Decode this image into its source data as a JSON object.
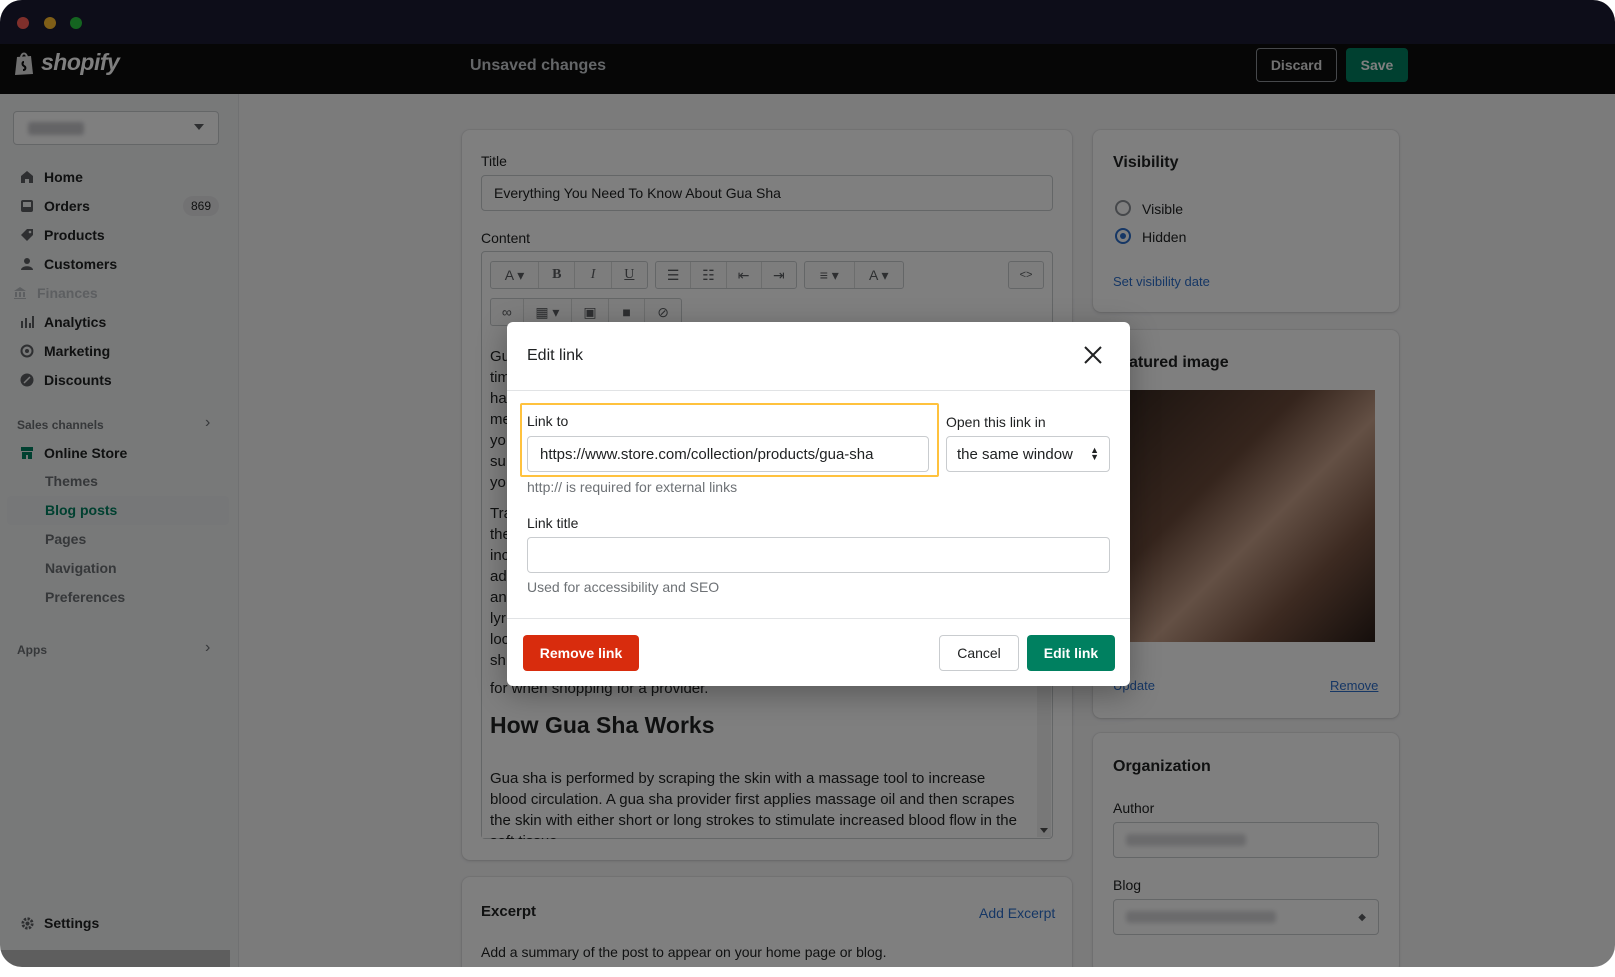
{
  "topbar": {
    "brand": "shopify",
    "status": "Unsaved changes",
    "discard_label": "Discard",
    "save_label": "Save"
  },
  "sidebar": {
    "nav": [
      {
        "label": "Home",
        "icon": "home-icon"
      },
      {
        "label": "Orders",
        "icon": "orders-icon",
        "badge": "869"
      },
      {
        "label": "Products",
        "icon": "tag-icon"
      },
      {
        "label": "Customers",
        "icon": "person-icon"
      },
      {
        "label": "Finances",
        "icon": "bank-icon",
        "disabled": true
      },
      {
        "label": "Analytics",
        "icon": "bar-chart-icon"
      },
      {
        "label": "Marketing",
        "icon": "target-icon"
      },
      {
        "label": "Discounts",
        "icon": "discount-icon"
      }
    ],
    "sales_channels_label": "Sales channels",
    "online_store": "Online Store",
    "online_store_items": [
      "Themes",
      "Blog posts",
      "Pages",
      "Navigation",
      "Preferences"
    ],
    "active_item": "Blog posts",
    "apps_label": "Apps",
    "settings_label": "Settings"
  },
  "main": {
    "title_label": "Title",
    "title_value": "Everything You Need To Know About Gua Sha",
    "content_label": "Content",
    "content": {
      "visible_line_starts": [
        "Gu",
        "tim",
        "ha",
        "me",
        "yo",
        "su",
        "yo",
        "Tra",
        "the",
        "inc",
        "ad",
        "an",
        "lyr",
        "loc",
        "sh"
      ],
      "partial_line": "for when shopping for a provider.",
      "heading": "How Gua Sha Works",
      "paragraph": "Gua sha is performed by scraping the skin with a massage tool to increase blood circulation. A gua sha provider first applies massage oil and then scrapes the skin with either short or long strokes to stimulate increased blood flow in the",
      "cut_line": "soft tissue"
    },
    "excerpt": {
      "title": "Excerpt",
      "action": "Add Excerpt",
      "description": "Add a summary of the post to appear on your home page or blog."
    }
  },
  "right": {
    "visibility": {
      "title": "Visibility",
      "options": [
        "Visible",
        "Hidden"
      ],
      "selected": "Hidden",
      "set_date_link": "Set visibility date"
    },
    "featured_image": {
      "title": "Featured image",
      "visible_title": "atured image",
      "update_label": "Update",
      "remove_label": "Remove"
    },
    "organization": {
      "title": "Organization",
      "author_label": "Author",
      "blog_label": "Blog"
    }
  },
  "modal": {
    "title": "Edit link",
    "link_to_label": "Link to",
    "link_to_value": "https://www.store.com/collection/products/gua-sha",
    "link_to_help": "http:// is required for external links",
    "open_in_label": "Open this link in",
    "open_in_value": "the same window",
    "link_title_label": "Link title",
    "link_title_value": "",
    "link_title_help": "Used for accessibility and SEO",
    "remove_label": "Remove link",
    "cancel_label": "Cancel",
    "submit_label": "Edit link"
  },
  "colors": {
    "primary_green": "#008060",
    "critical_red": "#d82c0d",
    "highlight_yellow": "#ffc23e",
    "link_blue": "#2c6ecb",
    "topbar_bg": "#0c0c0c"
  }
}
